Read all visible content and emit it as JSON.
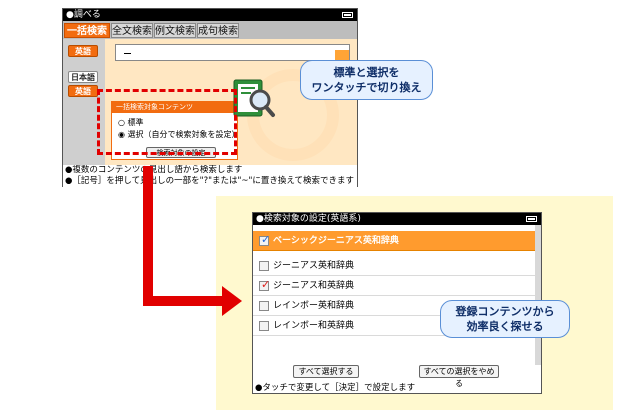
{
  "screen1": {
    "title": "●調べる",
    "tabs": [
      "一括検索",
      "全文検索",
      "例文検索",
      "成句検索"
    ],
    "side_buttons": [
      "英語",
      "日本語",
      "英語"
    ],
    "input_value": "",
    "dialog": {
      "header": "一括検索対象コンテンツ",
      "option_standard": "○ 標準",
      "option_select": "◉ 選択（自分で検索対象を設定）",
      "settings_button": "検索対象の設定"
    },
    "footer_line1": "●複数のコンテンツの見出し語から検索します",
    "footer_line2": "●［記号］を押して見出しの一部を\"?\"または\"~\"に置き換えて検索できます"
  },
  "callout_top": {
    "line1": "標準と選択を",
    "line2": "ワンタッチで切り換え"
  },
  "screen2": {
    "title": "●検索対象の設定(英語系)",
    "rows": [
      {
        "label": "ベーシックジーニアス英和辞典",
        "checked": true,
        "selected": true
      },
      {
        "label": "ジーニアス英和辞典",
        "checked": false,
        "selected": false
      },
      {
        "label": "ジーニアス和英辞典",
        "checked": true,
        "selected": false
      },
      {
        "label": "レインボー英和辞典",
        "checked": false,
        "selected": false
      },
      {
        "label": "レインボー和英辞典",
        "checked": false,
        "selected": false
      }
    ],
    "select_all": "すべて選択する",
    "deselect_all": "すべての選択をやめる",
    "footer": "●タッチで変更して［決定］で設定します"
  },
  "callout_bottom": {
    "line1": "登録コンテンツから",
    "line2": "効率良く探せる"
  },
  "colors": {
    "accent_orange": "#f26c10",
    "arrow_red": "#e10000",
    "panel_yellow": "#fff9cf",
    "callout_blue": "#e6f1ff"
  }
}
